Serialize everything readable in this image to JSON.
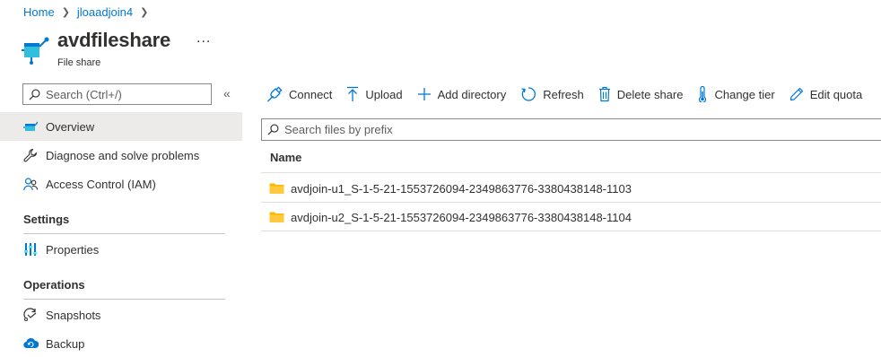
{
  "breadcrumb": {
    "items": [
      {
        "label": "Home"
      },
      {
        "label": "jloaadjoin4"
      }
    ],
    "separator": ">"
  },
  "resource": {
    "title": "avdfileshare",
    "subtitle": "File share",
    "more": "...",
    "icon": "file-share-icon"
  },
  "sidebar": {
    "search_placeholder": "Search (Ctrl+/)",
    "collapse": "«",
    "items": [
      {
        "label": "Overview",
        "icon": "file-share-icon",
        "active": true
      },
      {
        "label": "Diagnose and solve problems",
        "icon": "wrench-icon"
      },
      {
        "label": "Access Control (IAM)",
        "icon": "people-icon"
      }
    ],
    "sections": [
      {
        "title": "Settings",
        "items": [
          {
            "label": "Properties",
            "icon": "properties-icon"
          }
        ]
      },
      {
        "title": "Operations",
        "items": [
          {
            "label": "Snapshots",
            "icon": "snapshot-icon"
          },
          {
            "label": "Backup",
            "icon": "backup-cloud-icon"
          }
        ]
      }
    ]
  },
  "toolbar": {
    "connect": "Connect",
    "upload": "Upload",
    "add_directory": "Add directory",
    "refresh": "Refresh",
    "delete_share": "Delete share",
    "change_tier": "Change tier",
    "edit_quota": "Edit quota"
  },
  "files": {
    "search_placeholder": "Search files by prefix",
    "column_name": "Name",
    "rows": [
      {
        "name": "avdjoin-u1_S-1-5-21-1553726094-2349863776-3380438148-1103",
        "type": "folder"
      },
      {
        "name": "avdjoin-u2_S-1-5-21-1553726094-2349863776-3380438148-1104",
        "type": "folder"
      }
    ]
  },
  "colors": {
    "link": "#0078d4",
    "active_bg": "#edebe9",
    "folder": "#ffb900",
    "icon_blue": "#0078d4"
  }
}
